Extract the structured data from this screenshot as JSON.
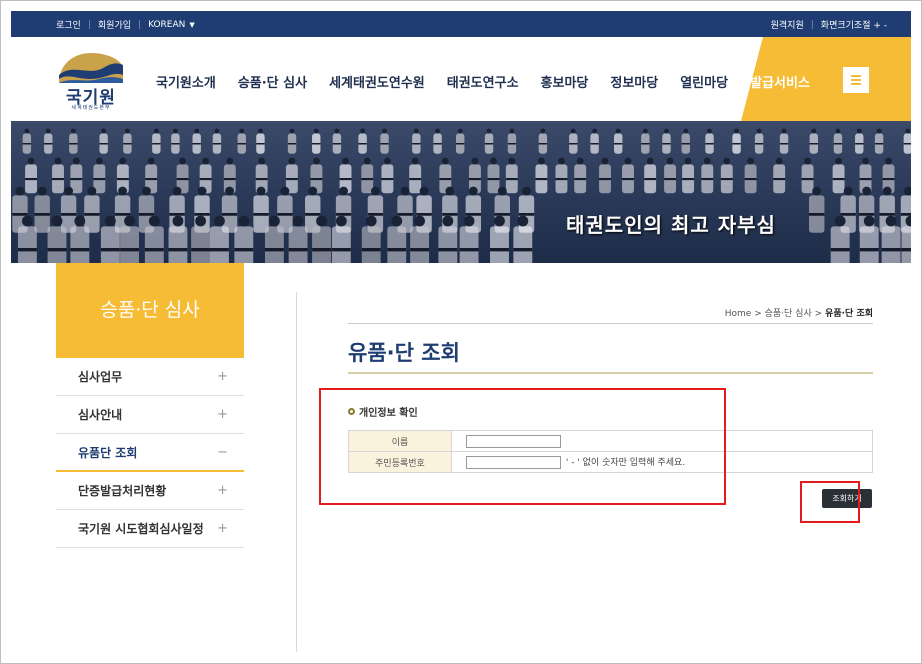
{
  "topbar": {
    "login": "로그인",
    "signup": "회원가입",
    "language": "KOREAN",
    "remote_support": "원격지원",
    "font_size": "화면크기조절 + -"
  },
  "header": {
    "logo_name": "국기원",
    "logo_sub": "세계태권도본부",
    "nav": [
      "국기원소개",
      "승품·단 심사",
      "세계태권도연수원",
      "태권도연구소",
      "홍보마당",
      "정보마당",
      "열린마당",
      "발급서비스"
    ]
  },
  "banner": {
    "slogan": "태권도인의 최고 자부심"
  },
  "sidebar": {
    "title": "승품·단 심사",
    "items": [
      {
        "label": "심사업무",
        "sign": "+"
      },
      {
        "label": "심사안내",
        "sign": "+"
      },
      {
        "label": "유품단 조회",
        "sign": "−"
      },
      {
        "label": "단증발급처리현황",
        "sign": "+"
      },
      {
        "label": "국기원 시도협회심사일정",
        "sign": "+"
      }
    ]
  },
  "breadcrumb": {
    "home": "Home",
    "sep": ">",
    "level1": "승품·단 심사",
    "current": "유품·단 조회"
  },
  "content": {
    "page_title": "유품·단 조회",
    "section_label": "개인정보 확인",
    "fields": {
      "name_label": "이름",
      "name_value": "",
      "rrn_label": "주민등록번호",
      "rrn_value": "",
      "rrn_hint": "' - ' 없이 숫자만 입력해 주세요."
    },
    "search_button": "조회하기"
  },
  "colors": {
    "navy": "#1f3d73",
    "accent_yellow": "#f7bc35",
    "highlight_red": "#e41c1c"
  }
}
